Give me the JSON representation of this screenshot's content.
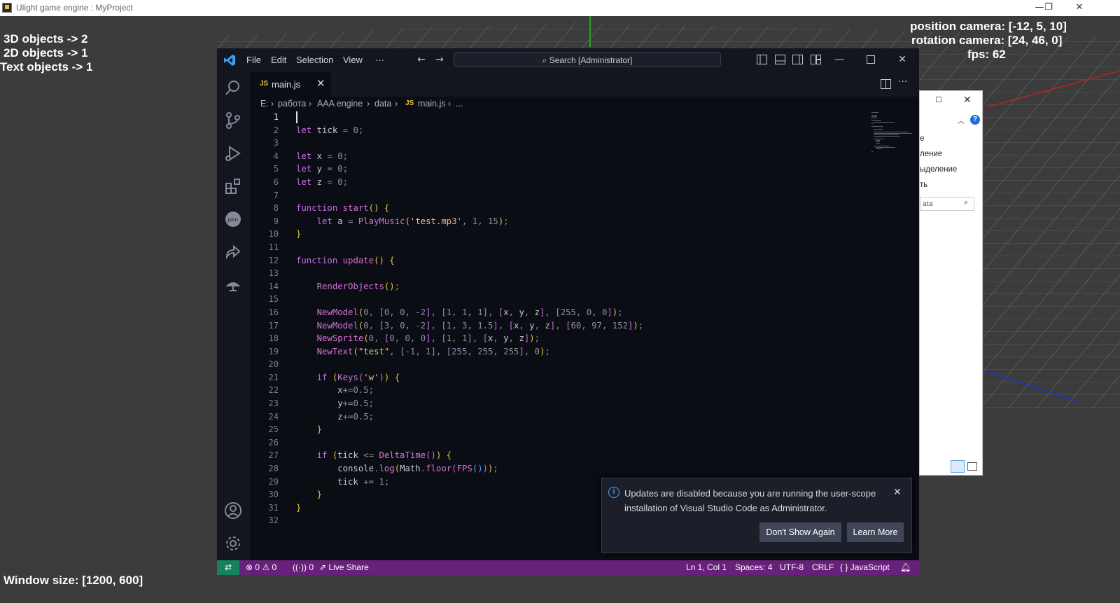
{
  "window": {
    "title": "Ulight game engine : MyProject",
    "minimize_glyph": "—",
    "restore_glyph": "❐",
    "close_glyph": "✕"
  },
  "hud": {
    "objects_3d": "3D objects -> 2",
    "objects_2d": "2D objects -> 1",
    "text_objects": "Text objects -> 1",
    "window_size": "Window size: [1200, 600]",
    "camera_position": "position camera: [-12, 5, 10]",
    "camera_rotation": "rotation camera: [24, 46, 0]",
    "fps": "fps: 62"
  },
  "vscode": {
    "menu": [
      "File",
      "Edit",
      "Selection",
      "View",
      "···"
    ],
    "search_placeholder": "Search [Administrator]",
    "tab": {
      "badge": "JS",
      "name": "main.js"
    },
    "breadcrumb": [
      "E:",
      "работа",
      "AAA engine",
      "data",
      "main.js",
      "..."
    ],
    "breadcrumb_badge": "JS",
    "line_numbers": [
      "1",
      "2",
      "3",
      "4",
      "5",
      "6",
      "7",
      "8",
      "9",
      "10",
      "11",
      "12",
      "13",
      "14",
      "15",
      "16",
      "17",
      "18",
      "19",
      "20",
      "21",
      "22",
      "23",
      "24",
      "25",
      "26",
      "27",
      "28",
      "29",
      "30",
      "31",
      "32"
    ],
    "code_lines": [
      "",
      "let tick = 0;",
      "",
      "let x = 0;",
      "let y = 0;",
      "let z = 0;",
      "",
      "function start() {",
      "    let a = PlayMusic('test.mp3', 1, 15);",
      "}",
      "",
      "function update() {",
      "",
      "    RenderObjects();",
      "",
      "    NewModel(0, [0, 0, -2], [1, 1, 1], [x, y, z], [255, 0, 0]);",
      "    NewModel(0, [3, 0, -2], [1, 3, 1.5], [x, y, z], [60, 97, 152]);",
      "    NewSprite(0, [0, 0, 0], [1, 1], [x, y, z]);",
      "    NewText(\"test\", [-1, 1], [255, 255, 255], 0);",
      "",
      "    if (Keys('w')) {",
      "        x+=0.5;",
      "        y+=0.5;",
      "        z+=0.5;",
      "    }",
      "",
      "    if (tick <= DeltaTime()) {",
      "        console.log(Math.floor(FPS()));",
      "        tick += 1;",
      "    }",
      "}",
      ""
    ],
    "status": {
      "errors": "0",
      "warnings": "0",
      "ports": "0",
      "live_share": "Live Share",
      "position": "Ln 1, Col 1",
      "spaces": "Spaces: 4",
      "encoding": "UTF-8",
      "eol": "CRLF",
      "language": "JavaScript",
      "language_glyph": "{ }"
    },
    "notification": {
      "message": "Updates are disabled because you are running the user-scope installation of Visual Studio Code as Administrator.",
      "button_dont_show": "Don't Show Again",
      "button_learn_more": "Learn More"
    }
  },
  "explorer_fragment": {
    "lines": [
      "е",
      "ление",
      "ыделение",
      "ть"
    ],
    "search_text": "ata"
  },
  "colors": {
    "status_bar": "#68217a",
    "remote_button": "#16825d",
    "editor_bg": "#0b0d14",
    "hud_text": "#ffffff"
  }
}
